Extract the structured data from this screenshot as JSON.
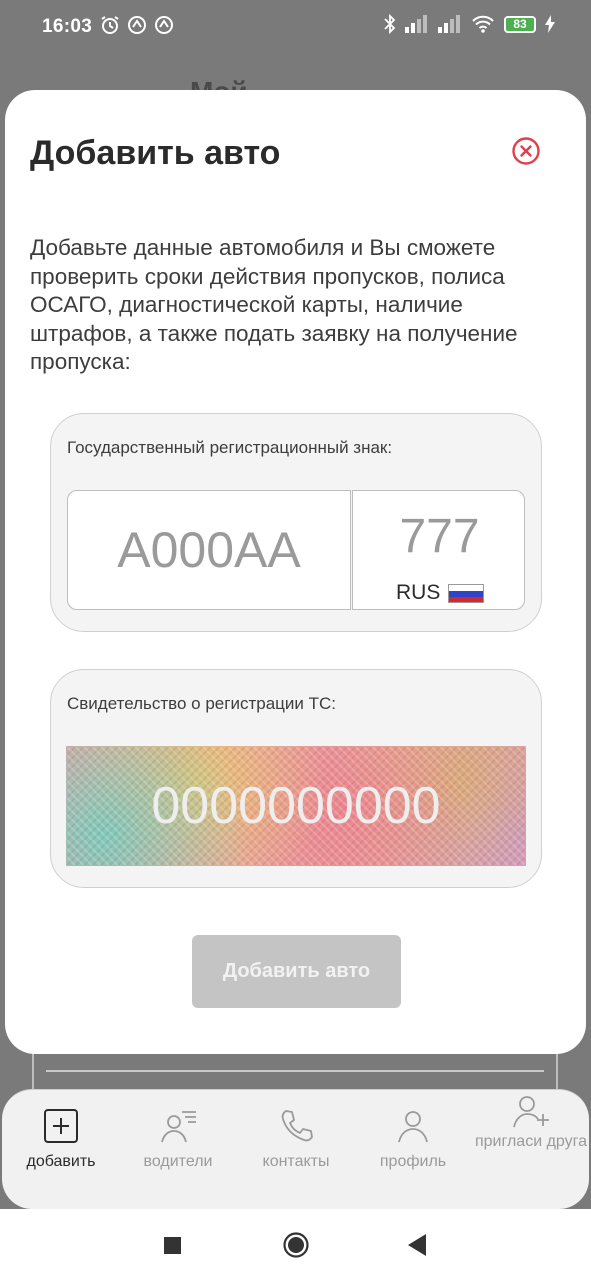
{
  "status_bar": {
    "time": "16:03",
    "battery": "83"
  },
  "background": {
    "title_fragment": "Мой"
  },
  "modal": {
    "title": "Добавить авто",
    "intro": "Добавьте данные автомобиля и Вы сможете проверить сроки действия пропусков, полиса ОСАГО, диагностической карты, наличие штрафов, а также подать заявку на получение пропуска:",
    "plate": {
      "label": "Государственный регистрационный знак:",
      "number_placeholder": "А000АА",
      "region_placeholder": "777",
      "country": "RUS"
    },
    "certificate": {
      "label": "Свидетельство о регистрации ТС:",
      "placeholder": "0000000000"
    },
    "submit_label": "Добавить авто"
  },
  "tabs": [
    {
      "label": "добавить",
      "icon": "plus-square-icon",
      "active": true
    },
    {
      "label": "водители",
      "icon": "drivers-icon",
      "active": false
    },
    {
      "label": "контакты",
      "icon": "phone-icon",
      "active": false
    },
    {
      "label": "профиль",
      "icon": "person-icon",
      "active": false
    },
    {
      "label": "пригласи друга",
      "icon": "invite-person-icon",
      "active": false
    }
  ],
  "colors": {
    "accent_close": "#e0404a",
    "button_disabled": "#c4c4c4",
    "tab_inactive": "#9a9a9a"
  }
}
